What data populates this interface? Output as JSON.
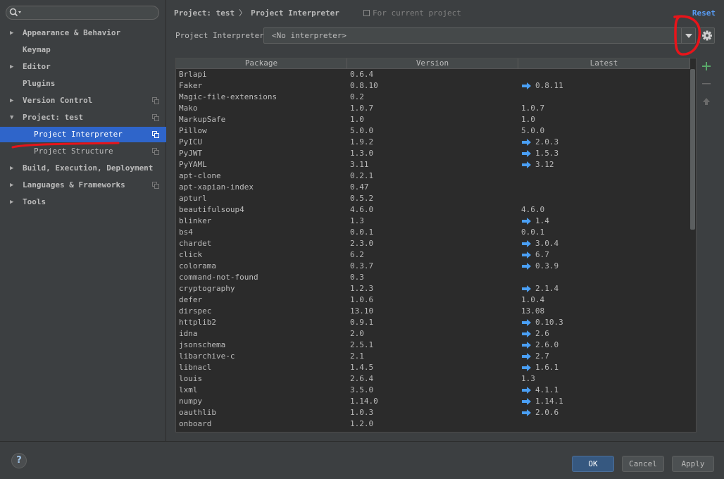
{
  "sidebar": {
    "search_value": "",
    "items": [
      {
        "label": "Appearance & Behavior",
        "expandable": true,
        "expanded": false
      },
      {
        "label": "Keymap",
        "expandable": false
      },
      {
        "label": "Editor",
        "expandable": true,
        "expanded": false
      },
      {
        "label": "Plugins",
        "expandable": false
      },
      {
        "label": "Version Control",
        "expandable": true,
        "expanded": false
      },
      {
        "label": "Project: test",
        "expandable": true,
        "expanded": true
      },
      {
        "label": "Project Interpreter",
        "child": true,
        "selected": true
      },
      {
        "label": "Project Structure",
        "child": true
      },
      {
        "label": "Build, Execution, Deployment",
        "expandable": true,
        "expanded": false
      },
      {
        "label": "Languages & Frameworks",
        "expandable": true,
        "expanded": false
      },
      {
        "label": "Tools",
        "expandable": true,
        "expanded": false
      }
    ]
  },
  "header": {
    "crumb_project": "Project: test",
    "crumb_separator": "〉",
    "crumb_page": "Project Interpreter",
    "for_current": "For current project",
    "reset": "Reset"
  },
  "interpreter": {
    "label": "Project Interpreter:",
    "value": "<No interpreter>"
  },
  "table": {
    "columns": [
      "Package",
      "Version",
      "Latest"
    ],
    "rows": [
      [
        "Brlapi",
        "0.6.4",
        "",
        false
      ],
      [
        "Faker",
        "0.8.10",
        "0.8.11",
        true
      ],
      [
        "Magic-file-extensions",
        "0.2",
        "",
        false
      ],
      [
        "Mako",
        "1.0.7",
        "1.0.7",
        false
      ],
      [
        "MarkupSafe",
        "1.0",
        "1.0",
        false
      ],
      [
        "Pillow",
        "5.0.0",
        "5.0.0",
        false
      ],
      [
        "PyICU",
        "1.9.2",
        "2.0.3",
        true
      ],
      [
        "PyJWT",
        "1.3.0",
        "1.5.3",
        true
      ],
      [
        "PyYAML",
        "3.11",
        "3.12",
        true
      ],
      [
        "apt-clone",
        "0.2.1",
        "",
        false
      ],
      [
        "apt-xapian-index",
        "0.47",
        "",
        false
      ],
      [
        "apturl",
        "0.5.2",
        "",
        false
      ],
      [
        "beautifulsoup4",
        "4.6.0",
        "4.6.0",
        false
      ],
      [
        "blinker",
        "1.3",
        "1.4",
        true
      ],
      [
        "bs4",
        "0.0.1",
        "0.0.1",
        false
      ],
      [
        "chardet",
        "2.3.0",
        "3.0.4",
        true
      ],
      [
        "click",
        "6.2",
        "6.7",
        true
      ],
      [
        "colorama",
        "0.3.7",
        "0.3.9",
        true
      ],
      [
        "command-not-found",
        "0.3",
        "",
        false
      ],
      [
        "cryptography",
        "1.2.3",
        "2.1.4",
        true
      ],
      [
        "defer",
        "1.0.6",
        "1.0.4",
        false
      ],
      [
        "dirspec",
        "13.10",
        "13.08",
        false
      ],
      [
        "httplib2",
        "0.9.1",
        "0.10.3",
        true
      ],
      [
        "idna",
        "2.0",
        "2.6",
        true
      ],
      [
        "jsonschema",
        "2.5.1",
        "2.6.0",
        true
      ],
      [
        "libarchive-c",
        "2.1",
        "2.7",
        true
      ],
      [
        "libnacl",
        "1.4.5",
        "1.6.1",
        true
      ],
      [
        "louis",
        "2.6.4",
        "1.3",
        false
      ],
      [
        "lxml",
        "3.5.0",
        "4.1.1",
        true
      ],
      [
        "numpy",
        "1.14.0",
        "1.14.1",
        true
      ],
      [
        "oauthlib",
        "1.0.3",
        "2.0.6",
        true
      ],
      [
        "onboard",
        "1.2.0",
        "",
        false
      ]
    ]
  },
  "footer": {
    "help": "?",
    "ok": "OK",
    "cancel": "Cancel",
    "apply": "Apply"
  },
  "colors": {
    "accent": "#2f65ca",
    "link": "#589df6",
    "upgrade_arrow": "#4a9ff5",
    "add_green": "#59a869",
    "annotation_red": "#e8141a"
  },
  "icons": [
    "search-icon",
    "gear-icon",
    "plus-icon",
    "minus-icon",
    "upgrade-icon",
    "help-icon",
    "copy-icon",
    "upgrade-arrow-icon"
  ]
}
